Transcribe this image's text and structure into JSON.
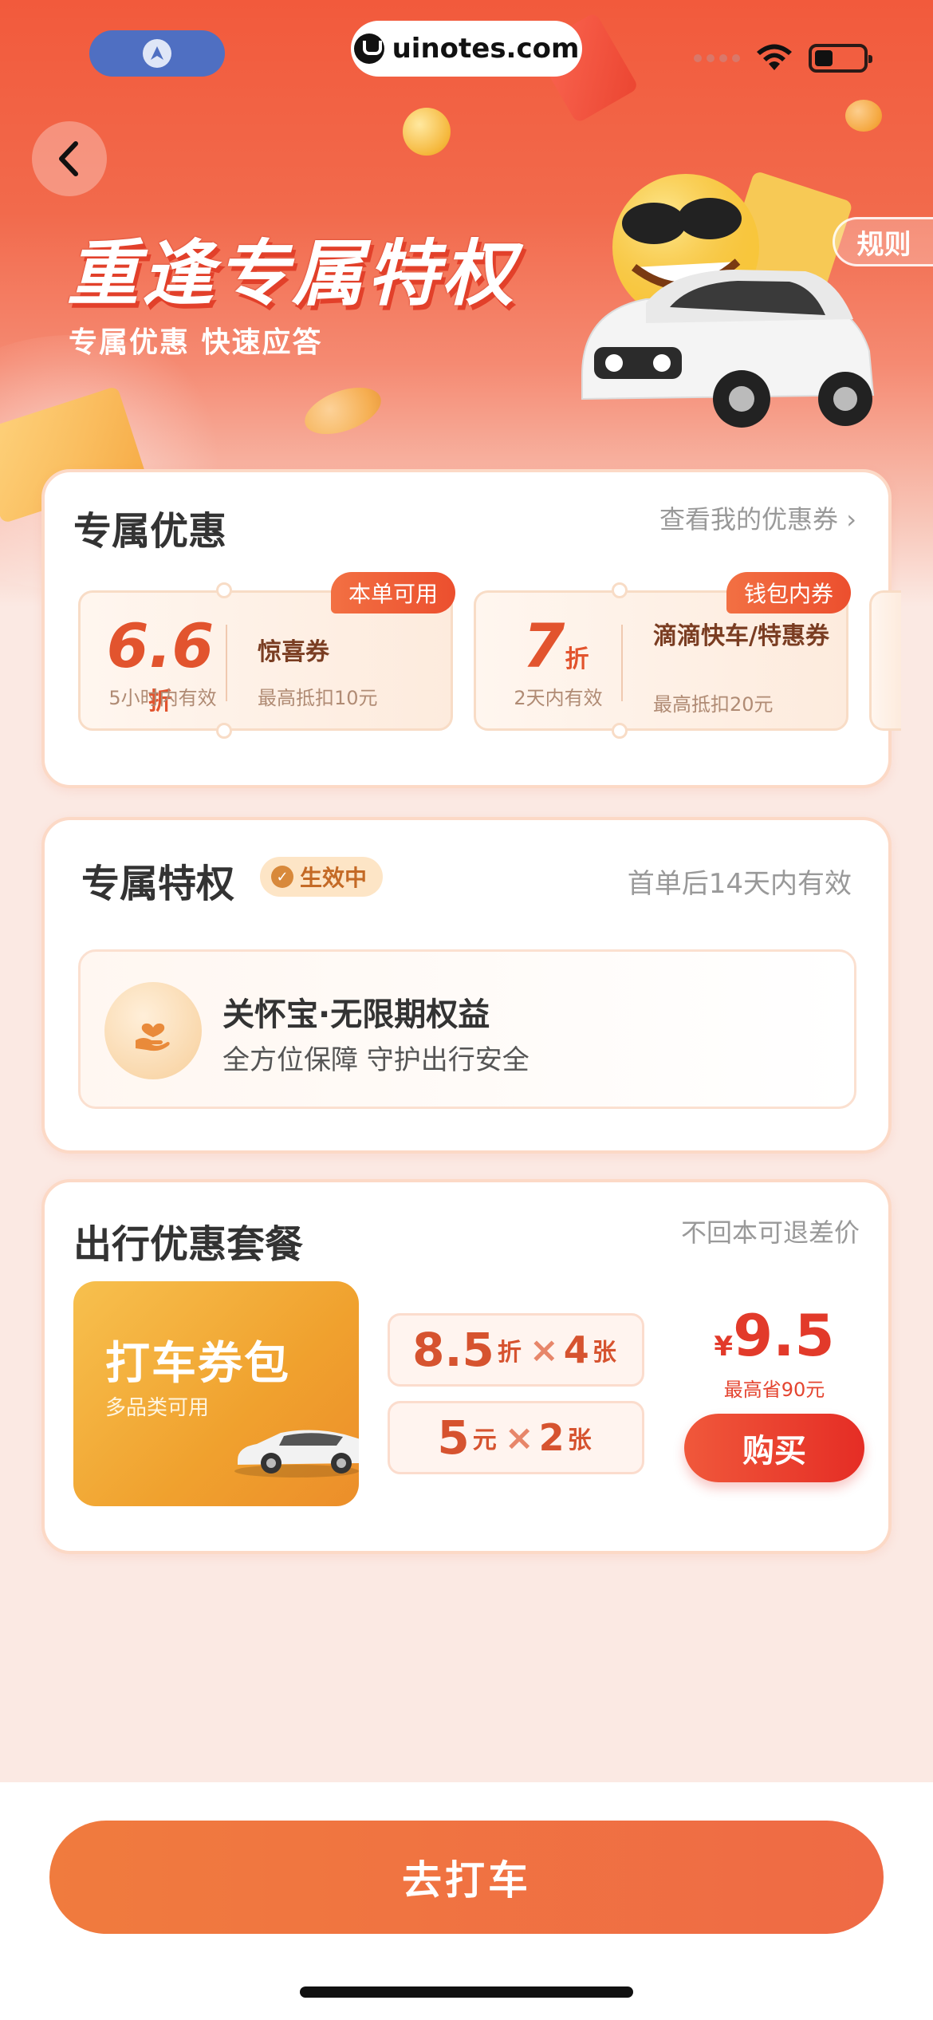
{
  "status": {
    "watermark": "uinotes.com"
  },
  "header": {
    "title": "重逢专属特权",
    "subtitle": "专属优惠 快速应答",
    "rules_label": "规则"
  },
  "offers": {
    "title": "专属优惠",
    "link": "查看我的优惠券",
    "coupons": [
      {
        "tag": "本单可用",
        "num": "6.6",
        "unit": "折",
        "valid": "5小时内有效",
        "name": "惊喜券",
        "limit": "最高抵扣10元"
      },
      {
        "tag": "钱包内券",
        "num": "7",
        "unit": "折",
        "valid": "2天内有效",
        "name": "滴滴快车/特惠券",
        "limit": "最高抵扣20元"
      }
    ]
  },
  "privilege": {
    "title": "专属特权",
    "badge": "生效中",
    "validity": "首单后14天内有效",
    "item_title": "关怀宝·无限期权益",
    "item_sub": "全方位保障 守护出行安全"
  },
  "package": {
    "title": "出行优惠套餐",
    "note": "不回本可退差价",
    "image_title": "打车券包",
    "image_sub": "多品类可用",
    "line1": {
      "num": "8.5",
      "unit": "折",
      "x": "×",
      "count": "4",
      "count_unit": "张"
    },
    "line2": {
      "num": "5",
      "unit": "元",
      "x": "×",
      "count": "2",
      "count_unit": "张"
    },
    "currency": "¥",
    "price": "9.5",
    "save": "最高省90元",
    "buy_label": "购买"
  },
  "footer": {
    "go_label": "去打车"
  },
  "colors": {
    "brand": "#f0583b",
    "accent_orange": "#f07b3e",
    "background": "#fbe9e3"
  }
}
